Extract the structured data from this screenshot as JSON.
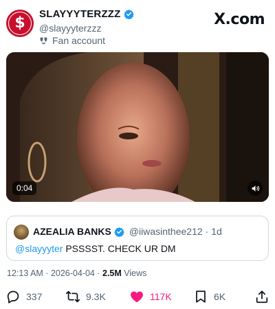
{
  "author": {
    "display_name": "SLAYYYTERZZZ",
    "handle": "@slayyyterzzz",
    "account_label": "Fan account",
    "avatar_glyph": "$",
    "avatar_color": "#c8102e"
  },
  "brand": "X.com",
  "video": {
    "timestamp": "0:04"
  },
  "quoted_tweet": {
    "display_name": "AZEALIA BANKS",
    "handle": "@iiwasinthee212",
    "age": "· 1d",
    "mention": "@slayyyter",
    "text": " PSSSST. CHECK UR DM"
  },
  "meta": {
    "time": "12:13 AM",
    "separator": " · ",
    "date": "2026-04-04",
    "views_count": "2.5M",
    "views_label": " Views"
  },
  "actions": {
    "replies": "337",
    "reposts": "9.3K",
    "likes": "117K",
    "bookmarks": "6K"
  },
  "colors": {
    "verified": "#1d9bf0",
    "like": "#f91880",
    "mention": "#1d9bf0",
    "secondary_text": "#536471"
  },
  "icons": [
    "verified-badge-icon",
    "fan-account-icon",
    "mute-icon",
    "reply-icon",
    "repost-icon",
    "like-icon",
    "bookmark-icon",
    "share-icon"
  ]
}
